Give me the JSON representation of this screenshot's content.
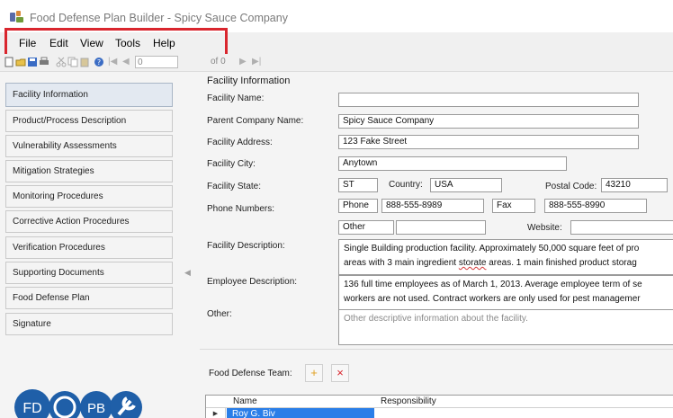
{
  "window": {
    "title": "Food Defense Plan Builder - Spicy Sauce Company"
  },
  "menu": {
    "file": "File",
    "edit": "Edit",
    "view": "View",
    "tools": "Tools",
    "help": "Help"
  },
  "toolbar": {
    "record_num": "0",
    "record_of": "of 0"
  },
  "sidebar": {
    "items": [
      {
        "label": "Facility Information"
      },
      {
        "label": "Product/Process Description"
      },
      {
        "label": "Vulnerability Assessments"
      },
      {
        "label": "Mitigation Strategies"
      },
      {
        "label": "Monitoring Procedures"
      },
      {
        "label": "Corrective Action Procedures"
      },
      {
        "label": "Verification Procedures"
      },
      {
        "label": "Supporting Documents"
      },
      {
        "label": "Food Defense Plan"
      },
      {
        "label": "Signature"
      }
    ],
    "logo_text_1": "FD",
    "logo_text_2": "PB"
  },
  "form": {
    "section_title": "Facility Information",
    "facility_name_label": "Facility Name:",
    "facility_name_value": "",
    "parent_company_label": "Parent Company Name:",
    "parent_company_value": "Spicy Sauce Company",
    "address_label": "Facility Address:",
    "address_value": "123 Fake Street",
    "city_label": "Facility City:",
    "city_value": "Anytown",
    "state_label": "Facility State:",
    "state_value": "ST",
    "country_label": "Country:",
    "country_value": "USA",
    "postal_label": "Postal Code:",
    "postal_value": "43210",
    "phone_label": "Phone Numbers:",
    "phone_type": "Phone",
    "phone_value": "888-555-8989",
    "fax_type": "Fax",
    "fax_value": "888-555-8990",
    "other_type": "Other",
    "other_value": "",
    "website_label": "Website:",
    "website_value": "",
    "description_label": "Facility Description:",
    "description_line1": "Single Building production facility.  Approximately 50,000 square feet of pro",
    "description_line2_a": "areas with 3 main ingredient ",
    "description_line2_b": "storate",
    "description_line2_c": " areas.  1 main finished product storag",
    "employee_label": "Employee Description:",
    "employee_line1": "136 full time employees as of March 1, 2013.  Average employee term of se",
    "employee_line2": "workers are not used.  Contract workers are only used for pest managemer",
    "other_label": "Other:",
    "other_placeholder": "Other descriptive information about the facility."
  },
  "team": {
    "label": "Food Defense Team:",
    "add_icon": "+",
    "remove_icon": "×",
    "col_name": "Name",
    "col_responsibility": "Responsibility",
    "row1_name": "Roy G. Biv"
  },
  "colors": {
    "highlight": "#d9262e",
    "selection": "#2a7ee8",
    "logo": "#1f5fa8"
  }
}
